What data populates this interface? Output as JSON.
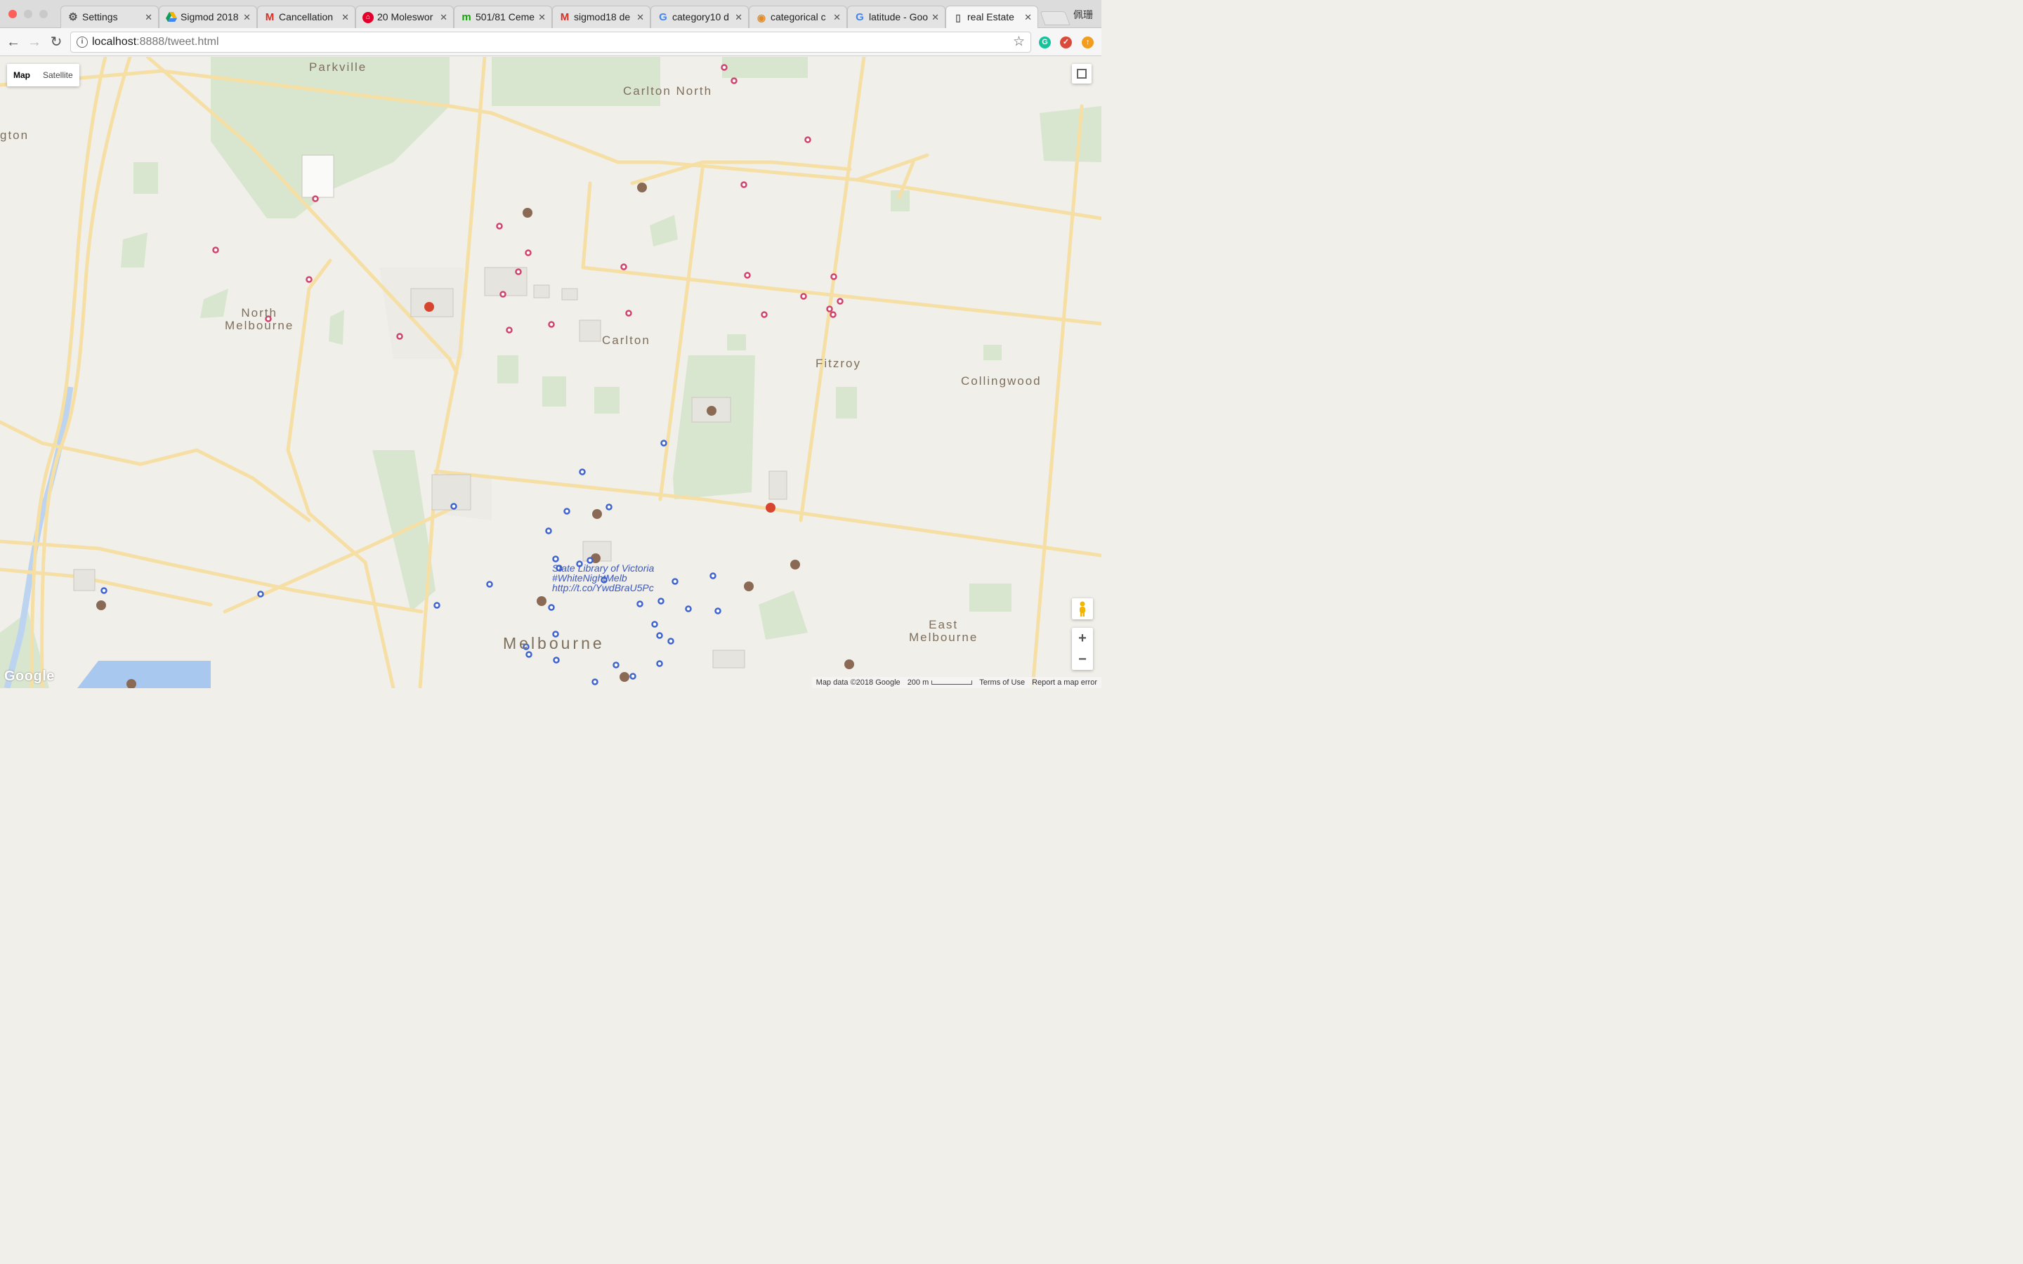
{
  "browser": {
    "tabs": [
      {
        "label": "Settings",
        "icon": "gear-icon",
        "active": false
      },
      {
        "label": "Sigmod 2018",
        "icon": "google-drive-icon",
        "active": false
      },
      {
        "label": "Cancellation",
        "icon": "gmail-icon",
        "active": false
      },
      {
        "label": "20 Moleswor",
        "icon": "realestate-icon",
        "active": false
      },
      {
        "label": "501/81 Ceme",
        "icon": "domain-icon",
        "active": false
      },
      {
        "label": "sigmod18 de",
        "icon": "gmail-icon",
        "active": false
      },
      {
        "label": "category10 d",
        "icon": "google-icon",
        "active": false
      },
      {
        "label": "categorical c",
        "icon": "stackoverflow-icon",
        "active": false
      },
      {
        "label": "latitude - Goo",
        "icon": "google-icon",
        "active": false
      },
      {
        "label": "real Estate",
        "icon": "document-icon",
        "active": true
      }
    ],
    "profile_name": "佩珊",
    "url_host": "localhost",
    "url_rest": ":8888/tweet.html"
  },
  "map": {
    "map_type": {
      "map": "Map",
      "satellite": "Satellite",
      "selected": "Map"
    },
    "suburbs": {
      "parkville": "Parkville",
      "carlton_north": "Carlton North",
      "edge_left": "gton",
      "north_melbourne": "North\nMelbourne",
      "carlton": "Carlton",
      "fitzroy": "Fitzroy",
      "collingwood": "Collingwood",
      "east_melbourne": "East\nMelbourne",
      "melbourne": "Melbourne"
    },
    "tweet_label": [
      "State Library of Victoria",
      "#WhiteNightMelb",
      "http://t.co/YwdBraU5Pc"
    ],
    "attribution": {
      "map_data": "Map data ©2018 Google",
      "scale": "200 m",
      "terms": "Terms of Use",
      "report": "Report a map error"
    },
    "logo": "Google",
    "colors": {
      "real_estate_marker": "#d0436e",
      "tweet_marker": "#3f63d1",
      "road": "#f6dfa4",
      "park": "#d8e6cf",
      "land": "#f1efe9"
    },
    "markers": {
      "real_estate_count": 33,
      "tweet_count": 41
    }
  }
}
